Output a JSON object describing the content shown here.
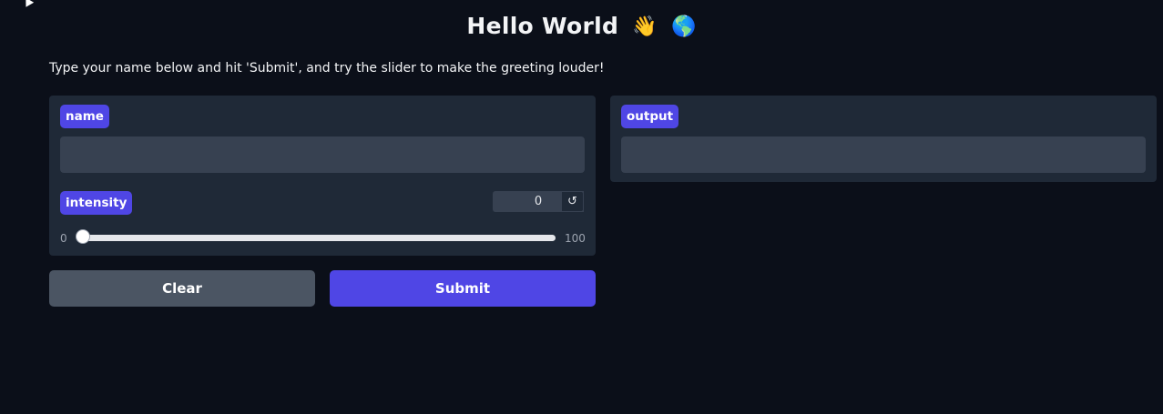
{
  "header": {
    "title": "Hello World",
    "emoji_wave": "👋",
    "emoji_globe": "🌎"
  },
  "description": "Type your name below and hit 'Submit', and try the slider to make the greeting louder!",
  "inputs": {
    "name": {
      "label": "name",
      "value": ""
    },
    "intensity": {
      "label": "intensity",
      "value": "0",
      "min": "0",
      "max": "100",
      "reset_icon": "↺"
    }
  },
  "output": {
    "label": "output",
    "value": ""
  },
  "buttons": {
    "clear": "Clear",
    "submit": "Submit"
  }
}
